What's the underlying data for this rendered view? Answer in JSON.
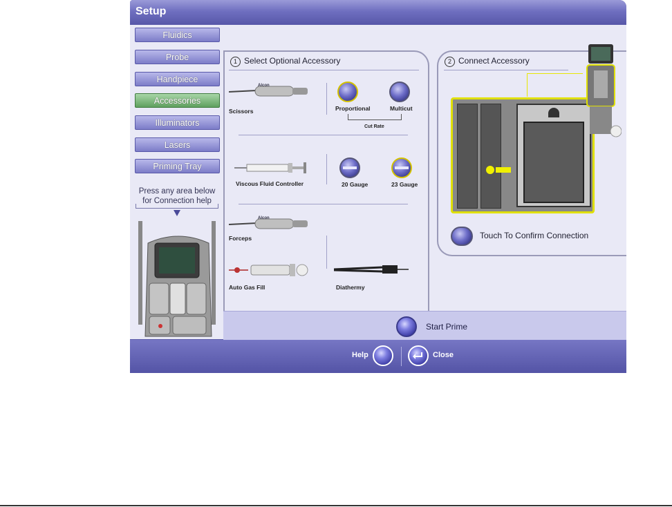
{
  "window": {
    "title": "Setup"
  },
  "nav": {
    "items": [
      {
        "label": "Fluidics",
        "active": false
      },
      {
        "label": "Probe",
        "active": false
      },
      {
        "label": "Handpiece",
        "active": false
      },
      {
        "label": "Accessories",
        "active": true
      },
      {
        "label": "Illuminators",
        "active": false
      },
      {
        "label": "Lasers",
        "active": false
      },
      {
        "label": "Priming Tray",
        "active": false
      }
    ],
    "help_text": "Press any area below for Connection help"
  },
  "step1": {
    "number": "1",
    "title": "Select Optional Accessory",
    "scissors": "Scissors",
    "proportional": "Proportional",
    "multicut": "Multicut",
    "cut_rate": "Cut Rate",
    "vfc": "Viscous Fluid Controller",
    "gauge20": "20 Gauge",
    "gauge23": "23 Gauge",
    "forceps": "Forceps",
    "autogas": "Auto Gas Fill",
    "diathermy": "Diathermy",
    "brand": "Alcon"
  },
  "step2": {
    "number": "2",
    "title": "Connect Accessory",
    "confirm": "Touch To Confirm Connection"
  },
  "actions": {
    "start_prime": "Start Prime",
    "help": "Help",
    "close": "Close"
  },
  "colors": {
    "accent": "#5a5aa8",
    "active_tab": "#6fae6f",
    "highlight": "#e8e800"
  }
}
